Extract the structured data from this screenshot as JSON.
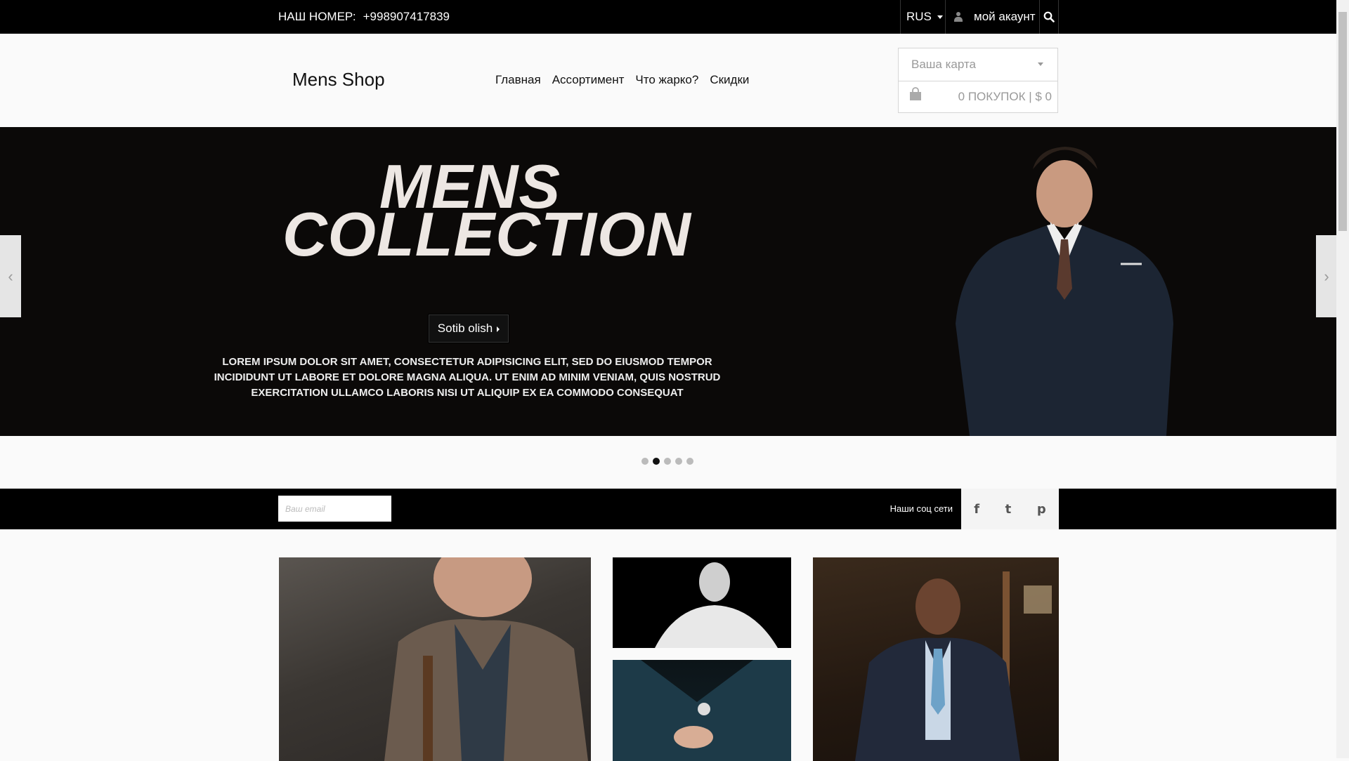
{
  "topbar": {
    "phone_label": "НАШ НОМЕР:",
    "phone_number": "+998907417839",
    "language": "RUS",
    "account_label": "мой акаунт",
    "icons": [
      "user-icon",
      "search-icon",
      "caret-down-icon"
    ]
  },
  "header": {
    "logo": "Mens Shop",
    "nav": [
      "Главная",
      "Ассортимент",
      "Что жарко?",
      "Скидки"
    ],
    "cart": {
      "select_label": "Ваша карта",
      "summary": "0 ПОКУПОК | $ 0",
      "icon": "shopping-bag-icon"
    }
  },
  "hero": {
    "title_line1": "MENS",
    "title_line2": "COLLECTION",
    "button_label": "Sotib olish",
    "text": "LOREM IPSUM DOLOR SIT AMET, CONSECTETUR ADIPISICING ELIT, SED DO EIUSMOD TEMPOR INCIDIDUNT UT LABORE ET DOLORE MAGNA ALIQUA. UT ENIM AD MINIM VENIAM, QUIS NOSTRUD EXERCITATION ULLAMCO LABORIS NISI UT ALIQUIP EX EA COMMODO CONSEQUAT",
    "prev_icon": "‹",
    "next_icon": "›",
    "slide_count": 5,
    "active_slide": 2
  },
  "subscribe": {
    "email_placeholder": "Ваш email",
    "social_label": "Наши соц сети",
    "social_icons": [
      {
        "name": "facebook-icon",
        "glyph": "f"
      },
      {
        "name": "twitter-icon",
        "glyph": "t"
      },
      {
        "name": "pinterest-icon",
        "glyph": "p"
      }
    ]
  },
  "colors": {
    "topbar_bg": "#000000",
    "hero_bg": "#0b0908",
    "page_bg": "#fafafa",
    "hero_title": "#ede7e3"
  }
}
